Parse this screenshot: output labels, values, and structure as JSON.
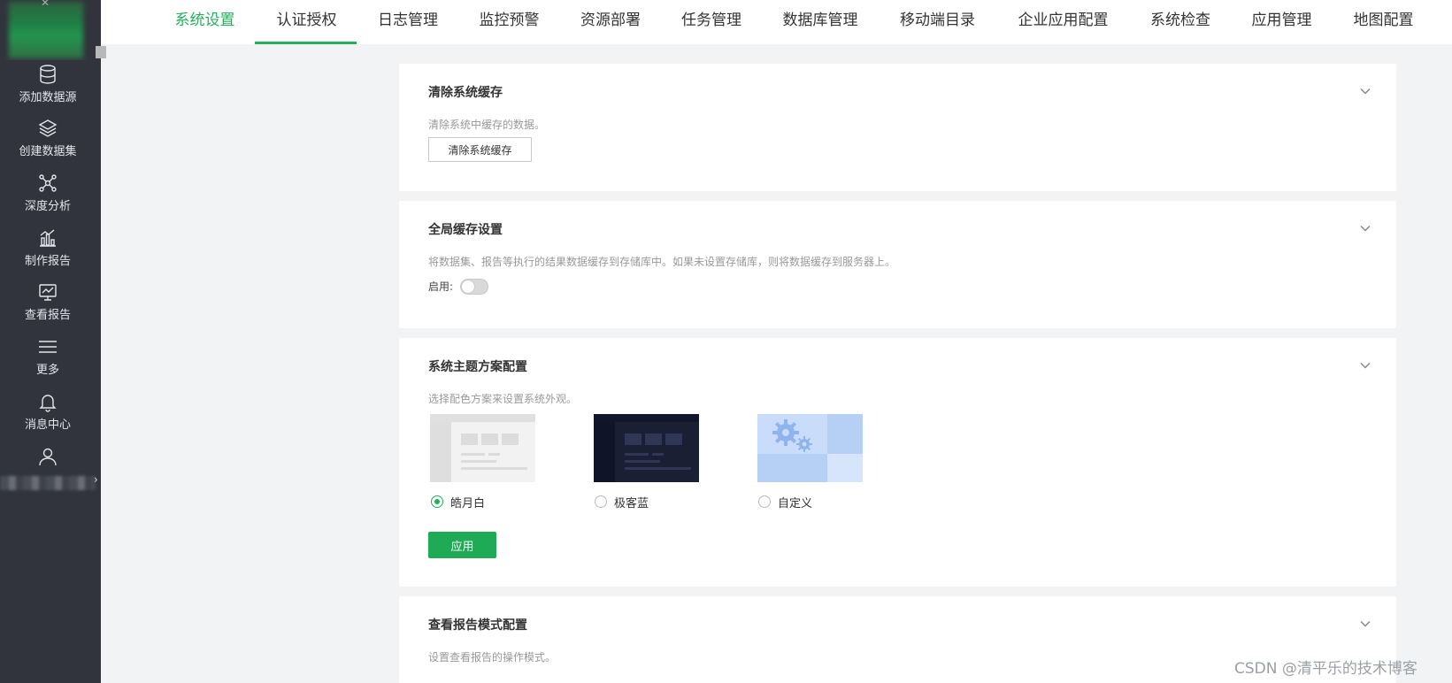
{
  "sidebar": {
    "items": [
      {
        "label": "添加数据源",
        "icon": "database-icon"
      },
      {
        "label": "创建数据集",
        "icon": "layers-icon"
      },
      {
        "label": "深度分析",
        "icon": "network-icon"
      },
      {
        "label": "制作报告",
        "icon": "bar-chart-icon"
      },
      {
        "label": "查看报告",
        "icon": "monitor-chart-icon"
      },
      {
        "label": "更多",
        "icon": "menu-icon"
      },
      {
        "label": "消息中心",
        "icon": "bell-icon"
      },
      {
        "label": "",
        "icon": "user-icon"
      }
    ]
  },
  "tabs": [
    {
      "label": "系统设置",
      "active": true
    },
    {
      "label": "认证授权"
    },
    {
      "label": "日志管理"
    },
    {
      "label": "监控预警"
    },
    {
      "label": "资源部署"
    },
    {
      "label": "任务管理"
    },
    {
      "label": "数据库管理"
    },
    {
      "label": "移动端目录"
    },
    {
      "label": "企业应用配置"
    },
    {
      "label": "系统检查"
    },
    {
      "label": "应用管理"
    },
    {
      "label": "地图配置"
    }
  ],
  "cache": {
    "title": "清除系统缓存",
    "desc": "清除系统中缓存的数据。",
    "button": "清除系统缓存"
  },
  "global_cache": {
    "title": "全局缓存设置",
    "desc": "将数据集、报告等执行的结果数据缓存到存储库中。如果未设置存储库，则将数据缓存到服务器上。",
    "enable_label": "启用:",
    "enabled": false
  },
  "theme": {
    "title": "系统主题方案配置",
    "desc": "选择配色方案来设置系统外观。",
    "options": [
      {
        "label": "皓月白",
        "checked": true
      },
      {
        "label": "极客蓝",
        "checked": false
      },
      {
        "label": "自定义",
        "checked": false
      }
    ],
    "apply_label": "应用"
  },
  "report_mode": {
    "title": "查看报告模式配置",
    "desc": "设置查看报告的操作模式。"
  },
  "watermark": "CSDN @清平乐的技术博客",
  "colors": {
    "accent": "#23b05a",
    "sidebar": "#31343d"
  }
}
